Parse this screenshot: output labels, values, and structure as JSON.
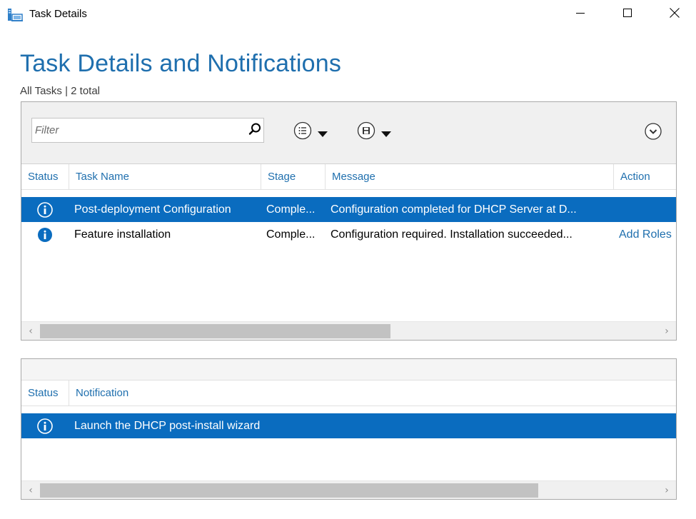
{
  "window": {
    "title": "Task Details",
    "app_icon": "server-manager-icon",
    "controls": {
      "minimize": "minimize-icon",
      "maximize": "maximize-icon",
      "close": "close-icon"
    }
  },
  "header": {
    "title": "Task Details and Notifications",
    "subtitle": "All Tasks | 2 total"
  },
  "tasks_panel": {
    "filter": {
      "placeholder": "Filter",
      "value": ""
    },
    "toolbar": {
      "view_options_icon": "list-options-icon",
      "save_icon": "save-icon",
      "expand_icon": "chevron-down-circle-icon"
    },
    "columns": [
      "Status",
      "Task Name",
      "Stage",
      "Message",
      "Action"
    ],
    "rows": [
      {
        "status_icon": "info-icon",
        "task_name": "Post-deployment Configuration",
        "stage": "Comple...",
        "message": "Configuration completed for DHCP Server at D...",
        "action": "",
        "selected": true
      },
      {
        "status_icon": "info-icon",
        "task_name": "Feature installation",
        "stage": "Comple...",
        "message": "Configuration required. Installation succeeded...",
        "action": "Add Roles",
        "selected": false
      }
    ],
    "scrollbar_position": 0
  },
  "notifications_panel": {
    "columns": [
      "Status",
      "Notification"
    ],
    "rows": [
      {
        "status_icon": "info-icon",
        "notification": "Launch the DHCP post-install wizard",
        "selected": true
      }
    ],
    "scrollbar_position": 0
  },
  "colors": {
    "accent": "#1f6fae",
    "selection": "#0a6cbf",
    "toolbar_bg": "#f0f0f0",
    "border": "#a9a9a9"
  }
}
